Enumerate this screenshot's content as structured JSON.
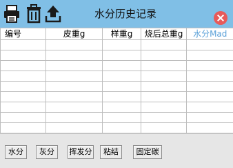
{
  "toolbar": {
    "title": "水分历史记录",
    "print_icon": "printer-icon",
    "delete_icon": "trash-icon",
    "export_icon": "upload-icon",
    "close_icon": "close-icon",
    "close_color": "#e85a5a"
  },
  "table": {
    "columns": [
      "编号",
      "皮重g",
      "样重g",
      "烧后总重g",
      "水分Mad"
    ],
    "rows": [
      [
        "",
        "",
        "",
        "",
        ""
      ],
      [
        "",
        "",
        "",
        "",
        ""
      ],
      [
        "",
        "",
        "",
        "",
        ""
      ],
      [
        "",
        "",
        "",
        "",
        ""
      ],
      [
        "",
        "",
        "",
        "",
        ""
      ],
      [
        "",
        "",
        "",
        "",
        ""
      ],
      [
        "",
        "",
        "",
        "",
        ""
      ],
      [
        "",
        "",
        "",
        "",
        ""
      ],
      [
        "",
        "",
        "",
        "",
        ""
      ]
    ]
  },
  "tabs": [
    "水分",
    "灰分",
    "挥发分",
    "粘结",
    "固定碳"
  ],
  "colors": {
    "titlebar_bg": "#80bfe6",
    "accent_header": "#5aa0d8"
  }
}
